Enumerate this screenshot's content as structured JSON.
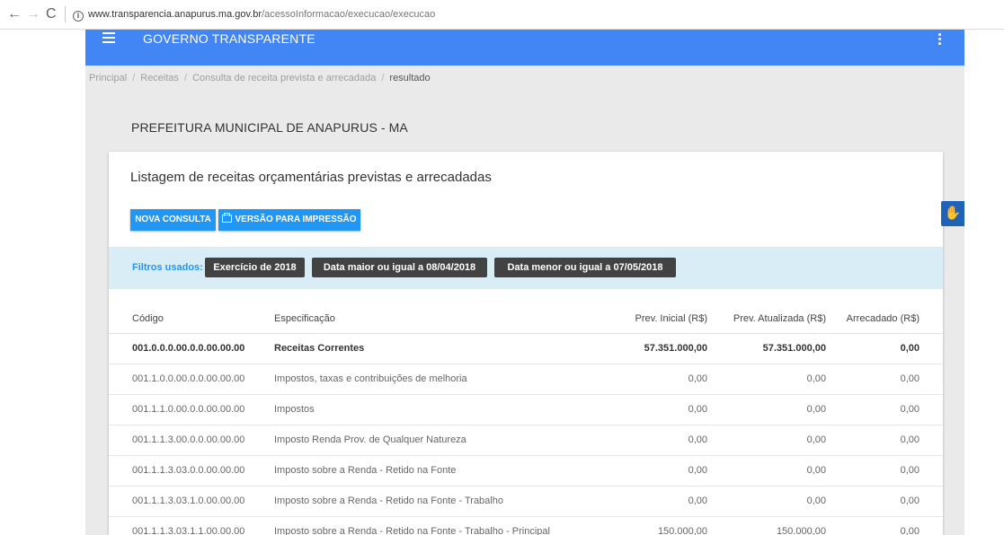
{
  "browser": {
    "url_domain": "www.transparencia.anapurus.ma.gov.br",
    "url_path": "/acessoInformacao/execucao/execucao"
  },
  "header": {
    "brand": "GOVERNO TRANSPARENTE"
  },
  "breadcrumb": [
    "Principal",
    "Receitas",
    "Consulta de receita prevista e arrecadada",
    "resultado"
  ],
  "org_title": "PREFEITURA MUNICIPAL DE ANAPURUS - MA",
  "card": {
    "title": "Listagem de receitas orçamentárias previstas e arrecadadas",
    "new_query_label": "NOVA CONSULTA",
    "print_label": "VERSÃO PARA IMPRESSÃO"
  },
  "filters": {
    "label": "Filtros usados:",
    "chips": [
      "Exercício de 2018",
      "Data maior ou igual a 08/04/2018",
      "Data menor ou igual a 07/05/2018"
    ]
  },
  "table": {
    "headers": {
      "code": "Código",
      "spec": "Especificação",
      "initial": "Prev. Inicial (R$)",
      "updated": "Prev. Atualizada (R$)",
      "collected": "Arrecadado (R$)"
    },
    "rows": [
      {
        "code": "001.0.0.0.00.0.0.00.00.00",
        "spec": "Receitas Correntes",
        "initial": "57.351.000,00",
        "updated": "57.351.000,00",
        "collected": "0,00"
      },
      {
        "code": "001.1.0.0.00.0.0.00.00.00",
        "spec": "Impostos, taxas e contribuições de melhoria",
        "initial": "0,00",
        "updated": "0,00",
        "collected": "0,00"
      },
      {
        "code": "001.1.1.0.00.0.0.00.00.00",
        "spec": "Impostos",
        "initial": "0,00",
        "updated": "0,00",
        "collected": "0,00"
      },
      {
        "code": "001.1.1.3.00.0.0.00.00.00",
        "spec": "Imposto Renda Prov. de Qualquer Natureza",
        "initial": "0,00",
        "updated": "0,00",
        "collected": "0,00"
      },
      {
        "code": "001.1.1.3.03.0.0.00.00.00",
        "spec": "Imposto sobre a Renda - Retido na Fonte",
        "initial": "0,00",
        "updated": "0,00",
        "collected": "0,00"
      },
      {
        "code": "001.1.1.3.03.1.0.00.00.00",
        "spec": "Imposto sobre a Renda - Retido na Fonte - Trabalho",
        "initial": "0,00",
        "updated": "0,00",
        "collected": "0,00"
      },
      {
        "code": "001.1.1.3.03.1.1.00.00.00",
        "spec": "Imposto sobre a Renda - Retido na Fonte - Trabalho - Principal",
        "initial": "150.000,00",
        "updated": "150.000,00",
        "collected": "0,00"
      }
    ]
  },
  "icons": {
    "back": "arrow-left-icon",
    "forward": "arrow-right-icon",
    "reload": "reload-icon",
    "info": "info-icon",
    "menu": "hamburger-menu-icon",
    "more": "kebab-menu-icon",
    "print": "printer-icon",
    "accessibility": "sign-language-hand-icon"
  },
  "colors": {
    "header": "#4285f4",
    "button": "#2196f3",
    "filters_bg": "#d9edf7",
    "chip": "#424242",
    "accessibility": "#1e63b8"
  }
}
